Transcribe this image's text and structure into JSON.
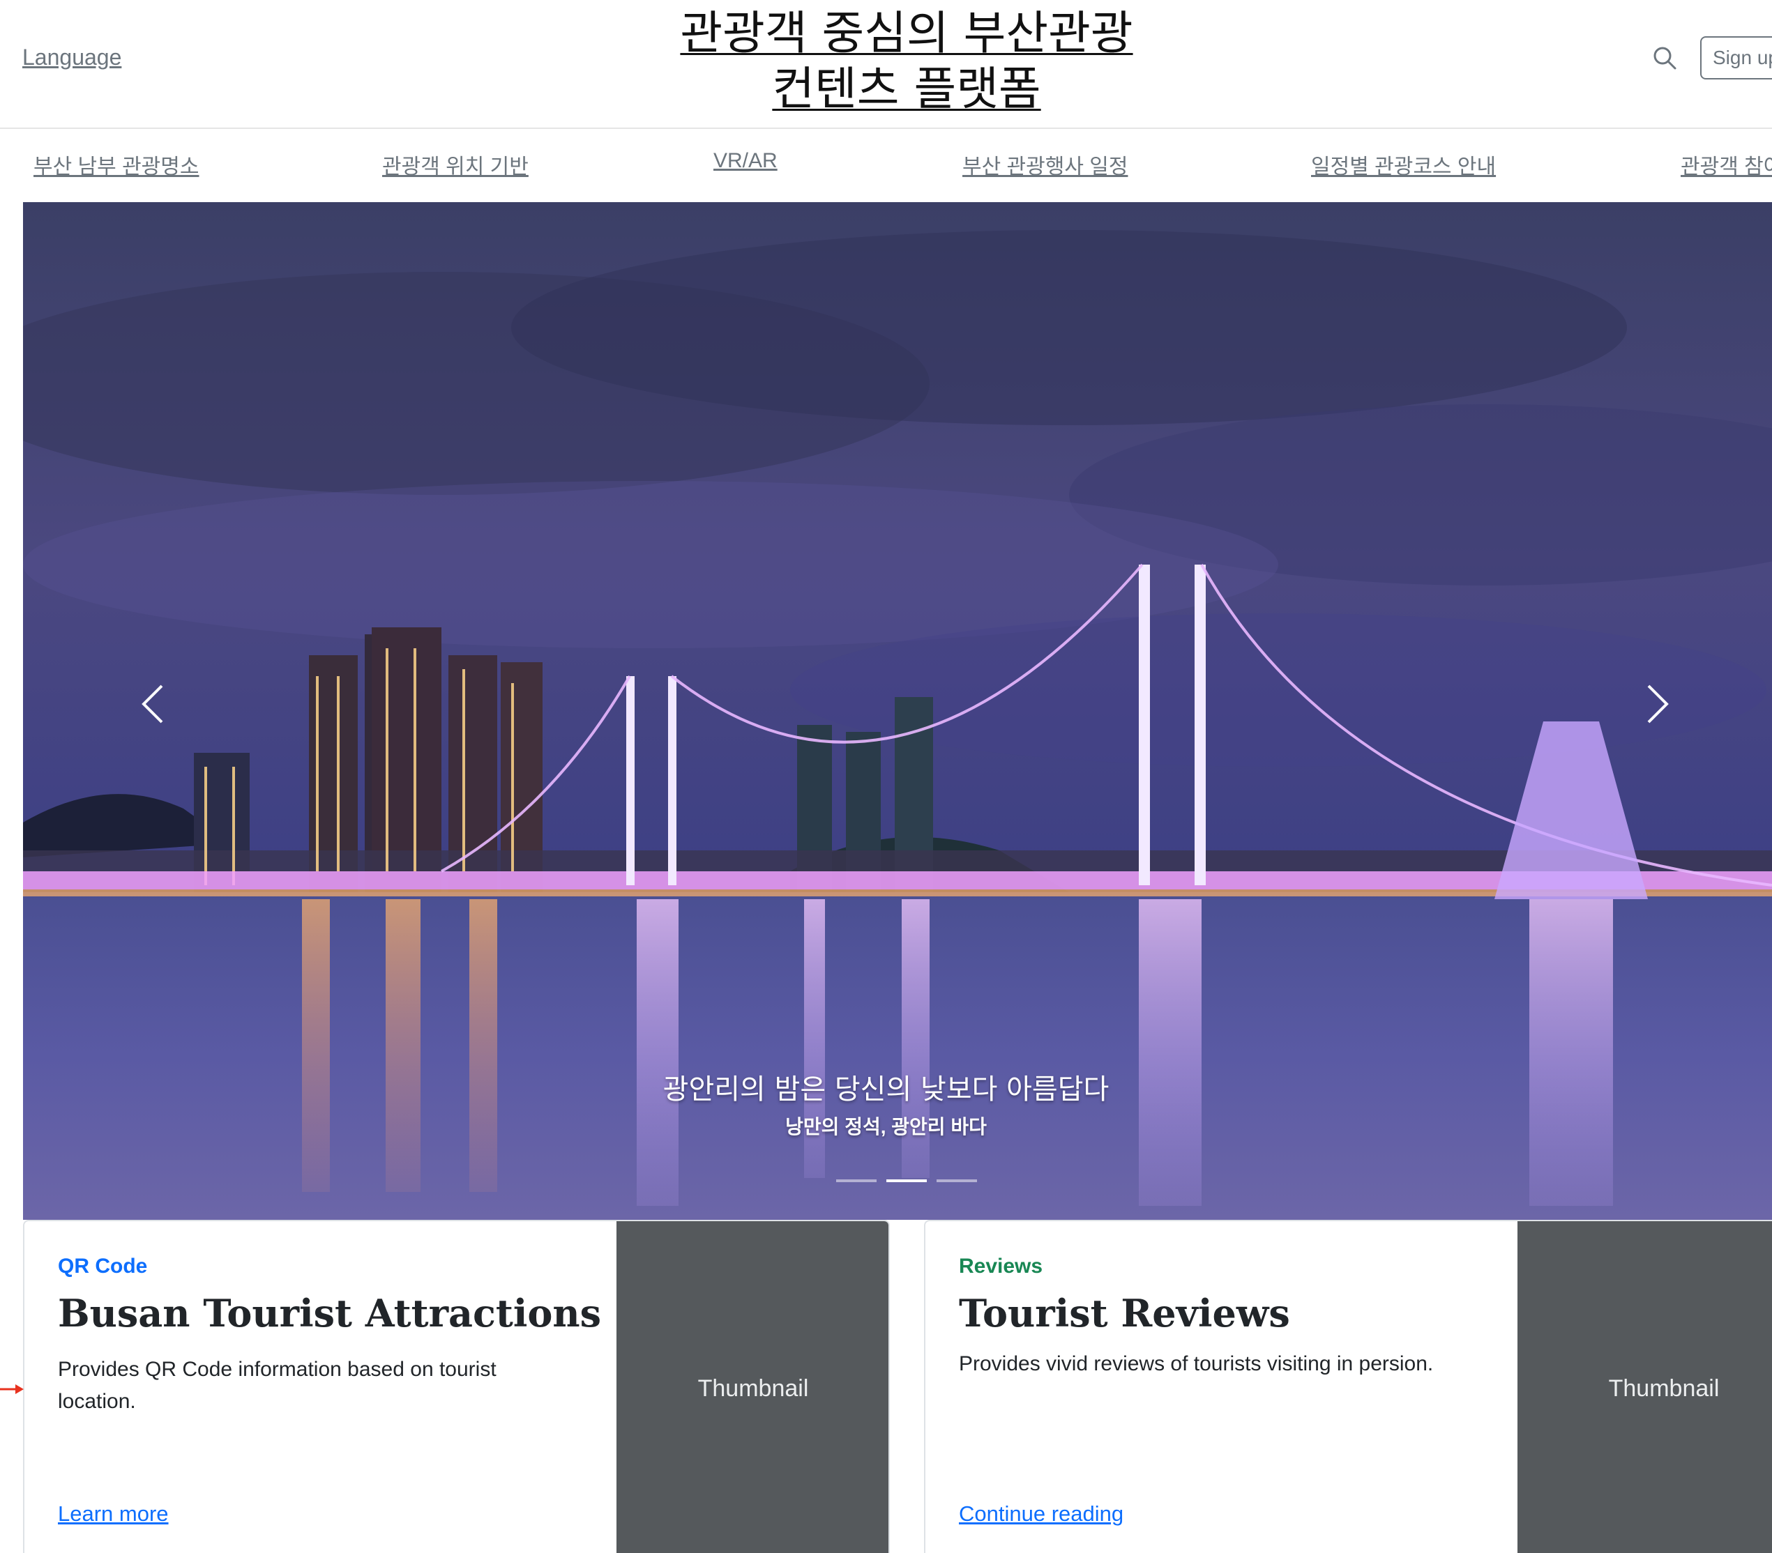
{
  "header": {
    "language_label": "Language",
    "site_title_line1": "관광객 중심의 부산관광",
    "site_title_line2": "컨텐츠 플랫폼",
    "search_icon": "search-icon",
    "signup_label": "Sign up"
  },
  "nav": {
    "items": [
      {
        "label": "부산 남부 관광명소"
      },
      {
        "label": "관광객 위치 기반"
      },
      {
        "label": "VR/AR"
      },
      {
        "label": "부산 관광행사 일정"
      },
      {
        "label": "일정별 관광코스 안내"
      },
      {
        "label": "관광객 참여"
      }
    ]
  },
  "hero": {
    "caption_title": "광안리의 밤은 당신의 낮보다 아름답다",
    "caption_subtitle": "낭만의 정석, 광안리 바다",
    "prev_icon": "chevron-left-icon",
    "next_icon": "chevron-right-icon",
    "slide_count": 3,
    "active_slide": 2
  },
  "cards": [
    {
      "category": "QR Code",
      "category_color": "#0d6efd",
      "title": "Busan Tourist Attractions",
      "text": "Provides QR Code information based on tourist location.",
      "link": "Learn more",
      "thumbnail": "Thumbnail"
    },
    {
      "category": "Reviews",
      "category_color": "#198754",
      "title": "Tourist Reviews",
      "text": "Provides vivid reviews of tourists visiting in persion.",
      "link": "Continue reading",
      "thumbnail": "Thumbnail"
    }
  ],
  "colors": {
    "link": "#0d6efd",
    "muted": "#6c757d",
    "thumbnail_bg": "#55595c",
    "annotation_arrow": "#e8321e"
  }
}
